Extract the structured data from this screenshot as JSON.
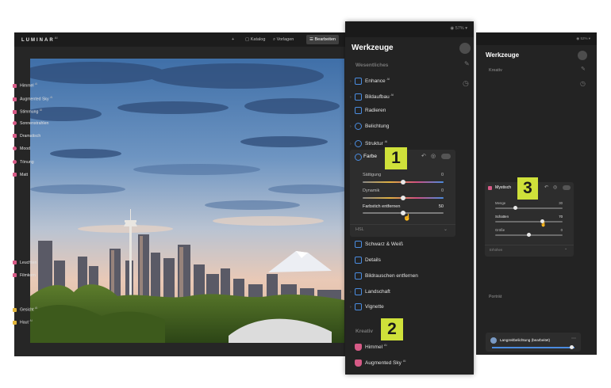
{
  "app": {
    "logo": "LUMINAR",
    "logo_sup": "AI",
    "toolbar": {
      "add": "+",
      "catalog": "Katalog",
      "presets": "Vorlagen",
      "edit": "Bearbeiten"
    }
  },
  "tools_panel": {
    "status": "57%",
    "title": "Werkzeuge",
    "section_essentials": "Wesentliches",
    "items_top": [
      {
        "label": "Enhance",
        "sup": "AI"
      },
      {
        "label": "Bildaufbau",
        "sup": "AI"
      },
      {
        "label": "Radieren",
        "sup": ""
      },
      {
        "label": "Belichtung",
        "sup": ""
      },
      {
        "label": "Struktur",
        "sup": "AI"
      }
    ],
    "farbe": {
      "label": "Farbe",
      "sliders": [
        {
          "label": "Sättigung",
          "value": "0",
          "level": 0.5
        },
        {
          "label": "Dynamik",
          "value": "0",
          "level": 0.5
        },
        {
          "label": "Farbstich entfernen",
          "value": "50",
          "level": 0.5
        }
      ],
      "hsl_label": "HSL"
    },
    "items_bottom": [
      {
        "label": "Schwarz & Weiß",
        "sup": ""
      },
      {
        "label": "Details",
        "sup": ""
      },
      {
        "label": "Bildrauschen entfernen",
        "sup": ""
      },
      {
        "label": "Landschaft",
        "sup": ""
      },
      {
        "label": "Vignette",
        "sup": ""
      }
    ],
    "section_creative": "Kreativ",
    "items_creative": [
      {
        "label": "Himmel",
        "sup": "AI"
      },
      {
        "label": "Augmented Sky",
        "sup": "AI"
      }
    ]
  },
  "badges": {
    "b1": "1",
    "b2": "2",
    "b3": "3"
  },
  "panel2": {
    "status": "52%",
    "title": "Werkzeuge",
    "section_creative": "Kreativ",
    "items": [
      {
        "label": "Himmel",
        "sup": "AI",
        "color": "#d65a86"
      },
      {
        "label": "Augmented Sky",
        "sup": "AI",
        "color": "#d65a86"
      },
      {
        "label": "Stimmung",
        "sup": "AI",
        "color": "#d65a86"
      },
      {
        "label": "Sonnenstrahlen",
        "sup": "",
        "color": "#d65a86"
      },
      {
        "label": "Dramatisch",
        "sup": "",
        "color": "#d65a86"
      },
      {
        "label": "Mood",
        "sup": "",
        "color": "#d65a86"
      },
      {
        "label": "Tönung",
        "sup": "",
        "color": "#d65a86"
      },
      {
        "label": "Matt",
        "sup": "",
        "color": "#d65a86"
      }
    ],
    "mystisch": {
      "label": "Mystisch",
      "sliders": [
        {
          "label": "Menge",
          "value": "30",
          "level": 0.3
        },
        {
          "label": "Schatten",
          "value": "70",
          "level": 0.7
        },
        {
          "label": "Größe",
          "value": "0",
          "level": 0.5
        }
      ],
      "more_label": "Erhöhen"
    },
    "items_after": [
      {
        "label": "Leuchten",
        "sup": "",
        "color": "#d65a86"
      },
      {
        "label": "Filmkorn",
        "sup": "",
        "color": "#d65a86"
      }
    ],
    "section_portrait": "Porträt",
    "items_portrait": [
      {
        "label": "Gesicht",
        "sup": "AI",
        "color": "#e0b43a"
      },
      {
        "label": "Haut",
        "sup": "AI",
        "color": "#e0b43a"
      }
    ],
    "bottom_item": "Langzeitbelichtung (bearbeitet)"
  },
  "colors": {
    "accent": "#cfe13a",
    "panel_bg": "#232323",
    "blue_icon": "#4a8ce0",
    "pink_icon": "#d65a86"
  }
}
